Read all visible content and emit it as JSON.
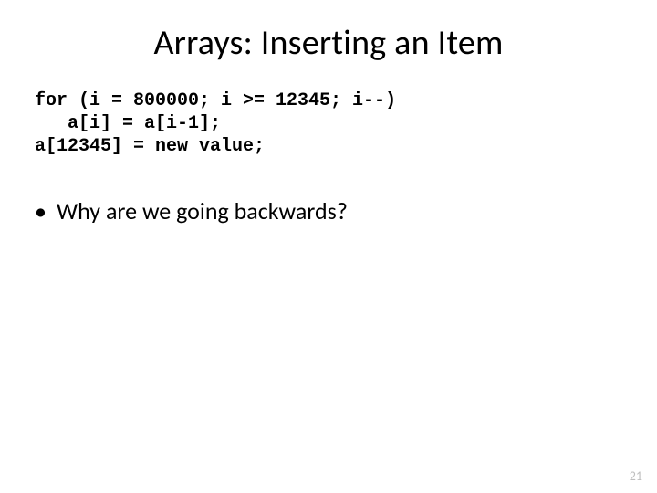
{
  "title": "Arrays: Inserting an Item",
  "code": {
    "line1": "for (i = 800000; i >= 12345; i--)",
    "line2": "   a[i] = a[i-1];",
    "line3": "a[12345] = new_value;"
  },
  "bullets": [
    "Why are we going backwards?"
  ],
  "page_number": "21"
}
